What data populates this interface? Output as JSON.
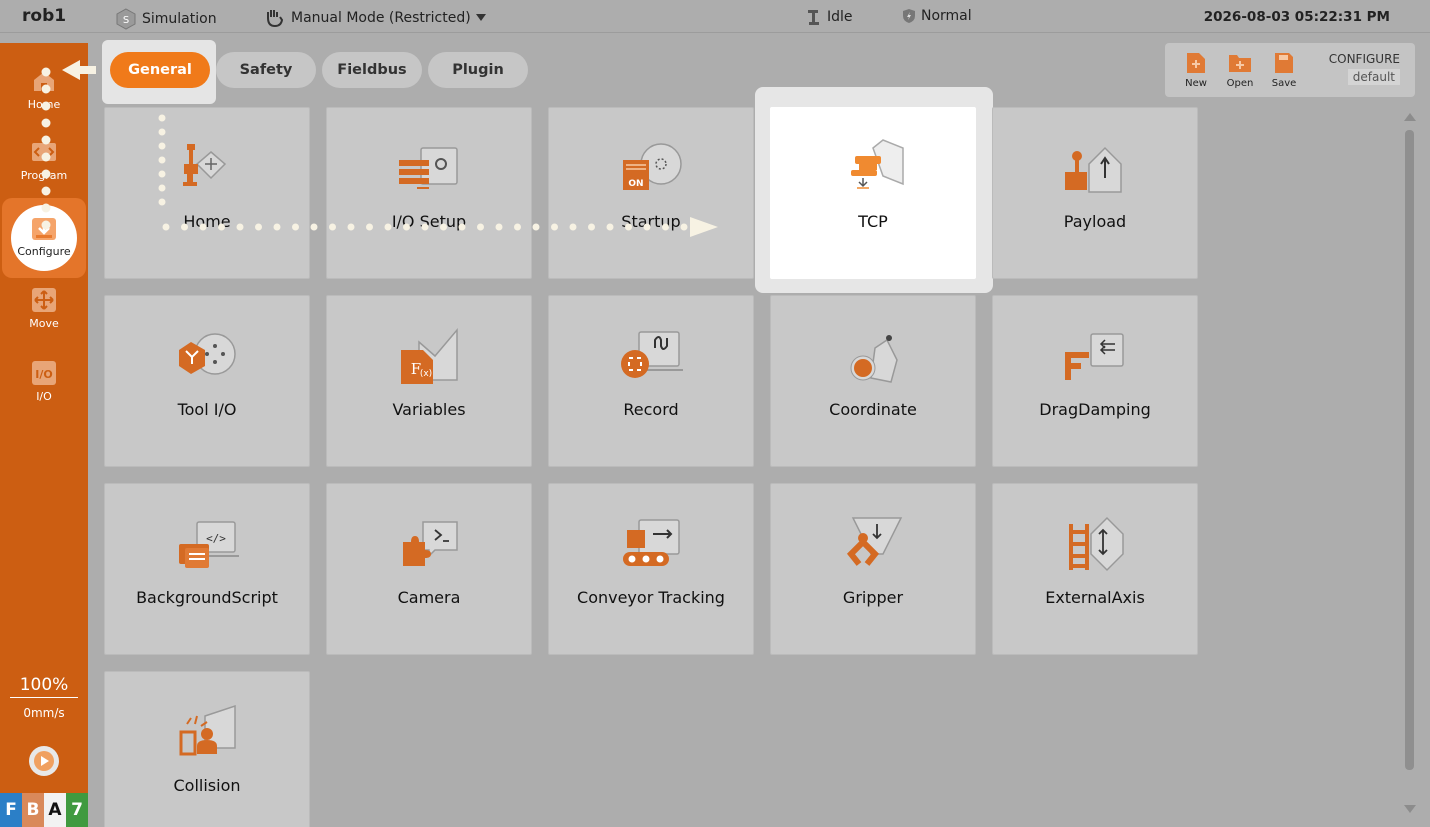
{
  "topbar": {
    "robot_name": "rob1",
    "simulation_label": "Simulation",
    "mode_label": "Manual Mode (Restricted)",
    "status_label": "Idle",
    "safety_label": "Normal",
    "datetime": "2026-08-03 05:22:31 PM"
  },
  "sidebar": {
    "home_label": "Home",
    "program_label": "Program",
    "configure_label": "Configure",
    "move_label": "Move",
    "io_label": "I/O",
    "speed_percent": "100%",
    "speed_value": "0mm/s",
    "status_letters": [
      "F",
      "B",
      "A",
      "7"
    ]
  },
  "tabs": {
    "general": "General",
    "safety": "Safety",
    "fieldbus": "Fieldbus",
    "plugin": "Plugin"
  },
  "config_panel": {
    "new_label": "New",
    "open_label": "Open",
    "save_label": "Save",
    "title": "CONFIGURE",
    "file_name": "default"
  },
  "tiles": [
    {
      "label": "Home",
      "icon": "home-robot-icon"
    },
    {
      "label": "I/O Setup",
      "icon": "io-setup-icon"
    },
    {
      "label": "Startup",
      "icon": "startup-icon"
    },
    {
      "label": "TCP",
      "icon": "tcp-icon"
    },
    {
      "label": "Payload",
      "icon": "payload-icon"
    },
    {
      "label": "Tool I/O",
      "icon": "tool-io-icon"
    },
    {
      "label": "Variables",
      "icon": "variables-icon"
    },
    {
      "label": "Record",
      "icon": "record-icon"
    },
    {
      "label": "Coordinate",
      "icon": "coordinate-icon"
    },
    {
      "label": "DragDamping",
      "icon": "drag-damping-icon"
    },
    {
      "label": "BackgroundScript",
      "icon": "background-script-icon"
    },
    {
      "label": "Camera",
      "icon": "camera-icon"
    },
    {
      "label": "Conveyor Tracking",
      "icon": "conveyor-icon"
    },
    {
      "label": "Gripper",
      "icon": "gripper-icon"
    },
    {
      "label": "ExternalAxis",
      "icon": "external-axis-icon"
    },
    {
      "label": "Collision",
      "icon": "collision-icon"
    }
  ],
  "colors": {
    "accent": "#f07a1a",
    "sidebar": "#cc5e12",
    "background": "#adadad",
    "tile": "#c8c8c8"
  }
}
